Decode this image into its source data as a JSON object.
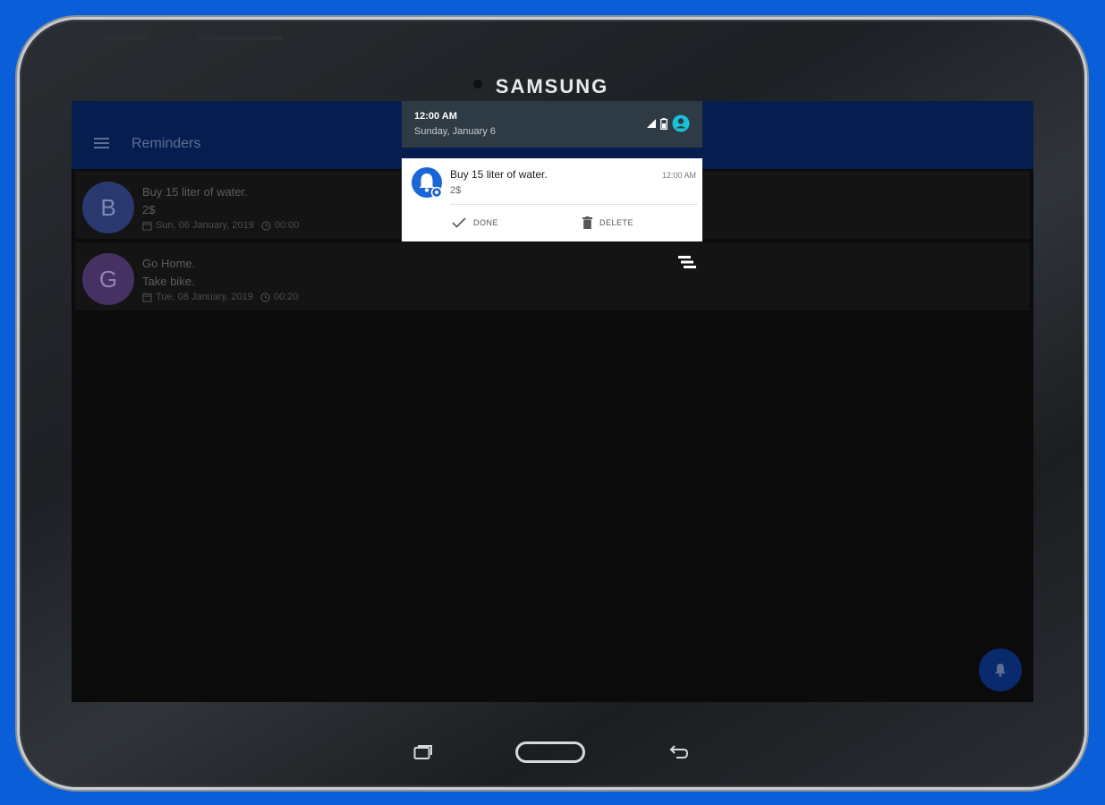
{
  "device": {
    "brand": "SAMSUNG"
  },
  "app": {
    "title": "Reminders",
    "menu_icon": "menu-icon"
  },
  "reminders": [
    {
      "initial": "B",
      "avatar_color": "#2a3870",
      "title": "Buy 15 liter of water.",
      "note": "2$",
      "date": "Sun, 06 January, 2019",
      "time": "00:00"
    },
    {
      "initial": "G",
      "avatar_color": "#463163",
      "title": "Go Home.",
      "note": "Take bike.",
      "date": "Tue, 08 January, 2019",
      "time": "00:20"
    }
  ],
  "status": {
    "time": "12:00 AM",
    "date": "Sunday, January 6"
  },
  "notification": {
    "title": "Buy 15 liter of water.",
    "text": "2$",
    "time": "12:00 AM",
    "actions": {
      "done": "DONE",
      "delete": "DELETE"
    },
    "accent": "#1b66d6"
  },
  "fab": {
    "icon": "bell-icon"
  }
}
